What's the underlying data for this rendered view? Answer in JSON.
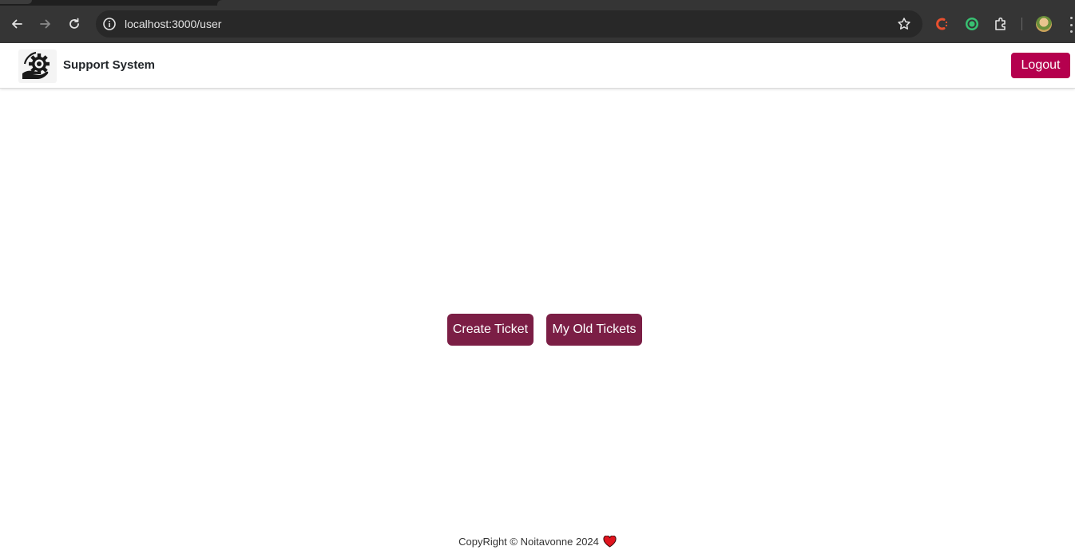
{
  "browser": {
    "url": "localhost:3000/user",
    "back_icon": "arrow-left-icon",
    "forward_icon": "arrow-right-icon",
    "reload_icon": "reload-icon",
    "site_info_icon": "info-icon",
    "bookmark_icon": "star-icon",
    "extensions": [
      "colorzilla-icon",
      "target-extension-icon",
      "puzzle-icon"
    ],
    "menu_icon": "kebab-menu-icon"
  },
  "navbar": {
    "brand_name": "Support System",
    "logo_icon": "gear-hand-icon",
    "logout_label": "Logout"
  },
  "main": {
    "create_ticket_label": "Create Ticket",
    "old_tickets_label": "My Old Tickets"
  },
  "footer": {
    "text": "CopyRight © Noitavonne 2024",
    "heart_icon": "heart-icon"
  },
  "colors": {
    "logout": "#b5004e",
    "primary_button": "#7b1e45",
    "heart": "#e0141e"
  }
}
